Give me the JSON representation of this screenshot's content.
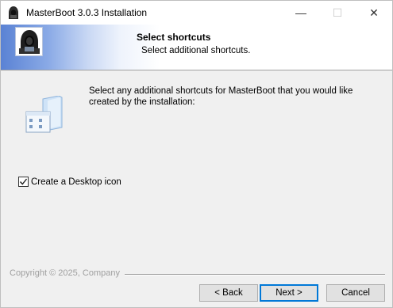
{
  "window": {
    "title": "MasterBoot 3.0.3 Installation",
    "controls": {
      "minimize": "—",
      "maximize": "☐",
      "close": "✕"
    }
  },
  "header": {
    "title": "Select shortcuts",
    "subtitle": "Select additional shortcuts."
  },
  "body": {
    "description": "Select any additional shortcuts for MasterBoot that you would like created by the installation:",
    "checkbox": {
      "label": "Create a Desktop icon",
      "checked": true
    }
  },
  "footer": {
    "copyright": "Copyright © 2025, Company",
    "buttons": {
      "back": "< Back",
      "next": "Next >",
      "cancel": "Cancel"
    }
  },
  "icons": {
    "title_icon": "hooded-hacker-icon",
    "header_logo": "hooded-hacker-logo",
    "page_icon": "shortcut-folder-icon"
  }
}
